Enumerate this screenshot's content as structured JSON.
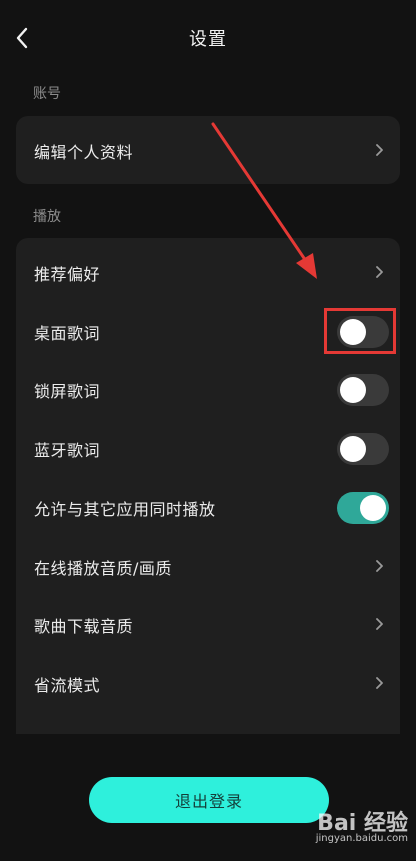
{
  "header": {
    "title": "设置"
  },
  "sections": {
    "account_label": "账号",
    "playback_label": "播放"
  },
  "account_items": {
    "edit_profile": "编辑个人资料"
  },
  "playback_items": {
    "recommend_pref": "推荐偏好",
    "desktop_lyrics": {
      "label": "桌面歌词",
      "enabled": false
    },
    "lockscreen_lyrics": {
      "label": "锁屏歌词",
      "enabled": false
    },
    "bluetooth_lyrics": {
      "label": "蓝牙歌词",
      "enabled": false
    },
    "allow_concurrent": {
      "label": "允许与其它应用同时播放",
      "enabled": true
    },
    "online_quality": "在线播放音质/画质",
    "download_quality": "歌曲下载音质",
    "data_saver": "省流模式"
  },
  "logout": {
    "label": "退出登录"
  },
  "watermark": {
    "logo": "Bai  经验",
    "site": "jingyan.baidu.com"
  },
  "colors": {
    "background": "#121212",
    "card": "#1f1f1f",
    "toggle_on": "#2fa899",
    "toggle_off": "#3a3a3a",
    "logout_button": "#2ef0dc",
    "annotation": "#e53935"
  },
  "icons": {
    "back": "back-arrow-icon",
    "row_chevron": "chevron-right-icon"
  }
}
